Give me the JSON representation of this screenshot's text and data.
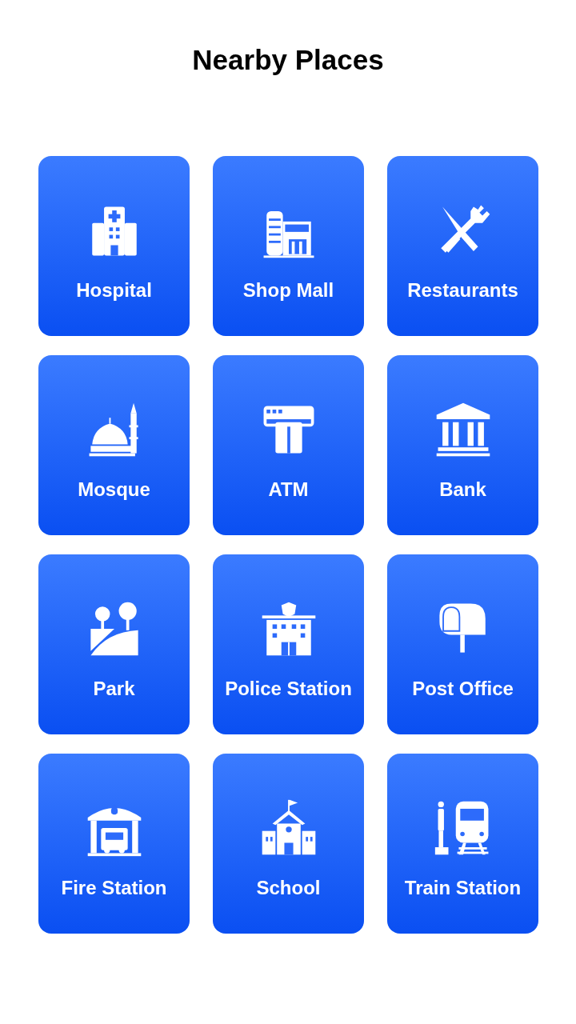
{
  "title": "Nearby Places",
  "places": [
    {
      "label": "Hospital",
      "kind": "hospital"
    },
    {
      "label": "Shop Mall",
      "kind": "mall"
    },
    {
      "label": "Restaurants",
      "kind": "restaurant"
    },
    {
      "label": "Mosque",
      "kind": "mosque"
    },
    {
      "label": "ATM",
      "kind": "atm"
    },
    {
      "label": "Bank",
      "kind": "bank"
    },
    {
      "label": "Park",
      "kind": "park"
    },
    {
      "label": "Police Station",
      "kind": "police"
    },
    {
      "label": "Post Office",
      "kind": "post"
    },
    {
      "label": "Fire Station",
      "kind": "fire"
    },
    {
      "label": "School",
      "kind": "school"
    },
    {
      "label": "Train Station",
      "kind": "train"
    }
  ]
}
